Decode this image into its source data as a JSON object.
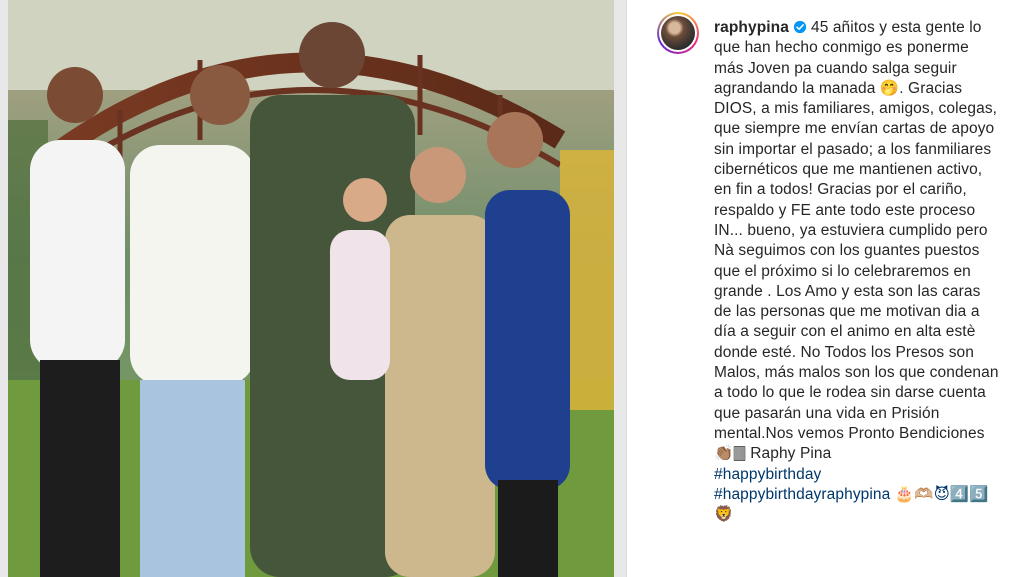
{
  "post": {
    "username": "raphypina",
    "verified_icon": "verified-badge-icon",
    "caption_main": "45 añitos y esta gente lo que han hecho conmigo es ponerme más Joven pa cuando salga seguir agrandando la manada 🤭. Gracias DIOS, a mis familiares, amigos, colegas, que siempre me envían cartas de apoyo sin importar el pasado; a los fanmiliares cibernéticos que me mantienen activo, en fin a todos! Gracias por el cariño, respaldo y FE ante todo este proceso IN... bueno, ya estuviera cumplido pero Nà seguimos con los guantes puestos que el próximo si lo celebraremos en grande . Los Amo y esta son las caras de las personas que me motivan dia a día a seguir con el animo en alta estè donde esté. No Todos los Presos son Malos, más malos son los que condenan a todo lo que le rodea sin darse cuenta que pasarán una vida en Prisión mental.Nos vemos Pronto Bendiciones 👏🏽🀫 Raphy Pina",
    "hashtags": [
      "#happybirthday",
      "#happybirthdayraphypina 🎂🫶🏼😈4️⃣5️⃣"
    ],
    "trailing_emoji": "🦁"
  },
  "colors": {
    "text": "#262626",
    "hashtag": "#00376b",
    "verified": "#0095f6",
    "divider": "#dbdbdb"
  }
}
